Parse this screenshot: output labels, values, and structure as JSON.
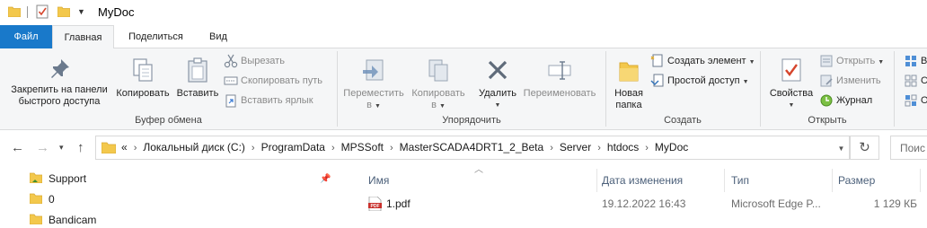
{
  "window": {
    "title": "MyDoc"
  },
  "ribbon_tabs": {
    "file": "Файл",
    "home": "Главная",
    "share": "Поделиться",
    "view": "Вид"
  },
  "ribbon": {
    "clipboard": {
      "pin": "Закрепить на панели быстрого доступа",
      "pin_line1": "Закрепить на панели",
      "pin_line2": "быстрого доступа",
      "copy": "Копировать",
      "paste": "Вставить",
      "cut": "Вырезать",
      "copy_path": "Скопировать путь",
      "paste_shortcut": "Вставить ярлык",
      "group_label": "Буфер обмена"
    },
    "organize": {
      "move_to_line1": "Переместить",
      "move_to_line2": "в",
      "copy_to_line1": "Копировать",
      "copy_to_line2": "в",
      "delete": "Удалить",
      "rename": "Переименовать",
      "group_label": "Упорядочить"
    },
    "new": {
      "new_folder_line1": "Новая",
      "new_folder_line2": "папка",
      "new_item": "Создать элемент",
      "easy_access": "Простой доступ",
      "group_label": "Создать"
    },
    "open": {
      "properties": "Свойства",
      "open": "Открыть",
      "edit": "Изменить",
      "history": "Журнал",
      "group_label": "Открыть"
    },
    "select": {
      "item1_partial": "В",
      "item2_partial": "С",
      "item3_partial": "О"
    }
  },
  "address_bar": {
    "overflow": "«",
    "crumbs": [
      "Локальный диск (C:)",
      "ProgramData",
      "MPSSoft",
      "MasterSCADA4DRT1_2_Beta",
      "Server",
      "htdocs",
      "MyDoc"
    ]
  },
  "search": {
    "placeholder": "Поис"
  },
  "nav_pane": {
    "items": [
      {
        "label": "Support",
        "pinned": true
      },
      {
        "label": "0"
      },
      {
        "label": "Bandicam"
      }
    ]
  },
  "file_list": {
    "columns": {
      "name": "Имя",
      "date": "Дата изменения",
      "type": "Тип",
      "size": "Размер"
    },
    "rows": [
      {
        "name": "1.pdf",
        "date": "19.12.2022 16:43",
        "type": "Microsoft Edge P...",
        "size": "1 129 КБ"
      }
    ]
  },
  "colors": {
    "file_tab": "#1979ca",
    "ribbon_bg": "#f5f6f7",
    "folder": "#f3c84c",
    "header_text": "#4c607a"
  }
}
